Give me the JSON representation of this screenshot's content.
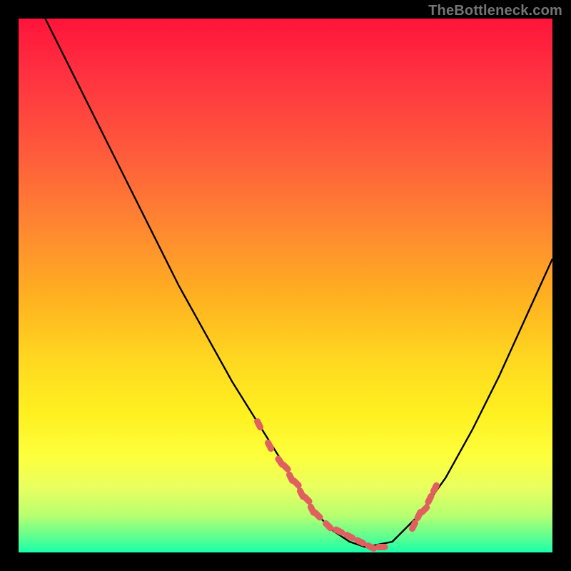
{
  "watermark": "TheBottleneck.com",
  "colors": {
    "frame": "#000000",
    "gradient_top": "#ff143a",
    "gradient_mid_upper": "#ff8a30",
    "gradient_mid": "#ffe020",
    "gradient_lower": "#b8ff70",
    "gradient_bottom": "#18ffaa",
    "curve_stroke": "#000000",
    "marker_fill": "#e06060",
    "marker_stroke": "#d85858"
  },
  "chart_data": {
    "type": "line",
    "title": "",
    "xlabel": "",
    "ylabel": "",
    "xlim": [
      0,
      100
    ],
    "ylim": [
      0,
      100
    ],
    "grid": false,
    "legend": false,
    "series": [
      {
        "name": "bottleneck-curve",
        "x": [
          0,
          5,
          10,
          15,
          20,
          25,
          30,
          35,
          40,
          45,
          50,
          53,
          56,
          59,
          62,
          65,
          70,
          75,
          80,
          85,
          90,
          95,
          100
        ],
        "values": [
          110,
          100,
          90,
          80,
          70,
          60,
          50,
          41,
          32,
          24,
          16,
          11,
          7,
          4,
          2,
          1,
          2,
          7,
          14,
          23,
          33,
          44,
          55
        ]
      }
    ],
    "markers": {
      "name": "highlight-region",
      "left_cluster": {
        "x": [
          45,
          47,
          49,
          50,
          51,
          52,
          53,
          54,
          55,
          56,
          58,
          60,
          62,
          64,
          66,
          68
        ],
        "values": [
          24,
          20,
          17,
          16,
          14,
          13,
          11,
          10,
          8,
          7,
          5,
          4,
          3,
          2,
          1,
          1
        ]
      },
      "right_cluster": {
        "x": [
          74,
          75,
          76,
          77,
          78
        ],
        "values": [
          5,
          7,
          8,
          10,
          12
        ]
      }
    }
  }
}
